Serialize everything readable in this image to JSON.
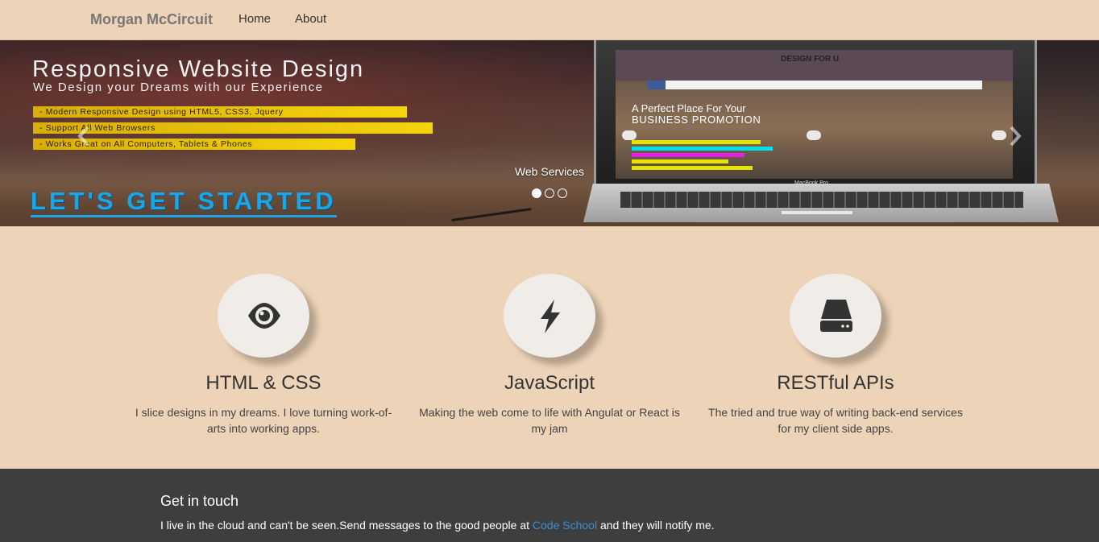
{
  "navbar": {
    "brand": "Morgan McCircuit",
    "links": [
      "Home",
      "About"
    ]
  },
  "carousel": {
    "slide": {
      "title": "Responsive Website Design",
      "subtitle": "We Design your Dreams with our Experience",
      "features": [
        "- Modern Responsive Design using HTML5, CSS3, Jquery",
        "- Support All Web Browsers",
        "- Works Great on All Computers, Tablets & Phones"
      ],
      "cta": "LET'S GET STARTED",
      "screen_logo": "DESIGN FOR U",
      "screen_headline": "A Perfect Place For Your",
      "screen_headline2": "BUSINESS PROMOTION",
      "laptop_label": "MacBook Pro"
    },
    "caption": "Web Services",
    "indicator_count": 3,
    "active_index": 0
  },
  "features": [
    {
      "icon": "eye-icon",
      "title": "HTML & CSS",
      "text": "I slice designs in my dreams. I love turning work-of-arts into working apps."
    },
    {
      "icon": "bolt-icon",
      "title": "JavaScript",
      "text": "Making the web come to life with Angulat or React is my jam"
    },
    {
      "icon": "server-icon",
      "title": "RESTful APIs",
      "text": "The tried and true way of writing back-end services for my client side apps."
    }
  ],
  "footer": {
    "heading": "Get in touch",
    "text_before": "I live in the cloud and can't be seen.Send messages to the good people at ",
    "link_text": "Code School",
    "text_after": " and they will notify me."
  },
  "colors": {
    "background": "#edd3b7",
    "footer_bg": "#3f3e3e",
    "link": "#3b8ed2",
    "cta": "#1aa7e8"
  }
}
